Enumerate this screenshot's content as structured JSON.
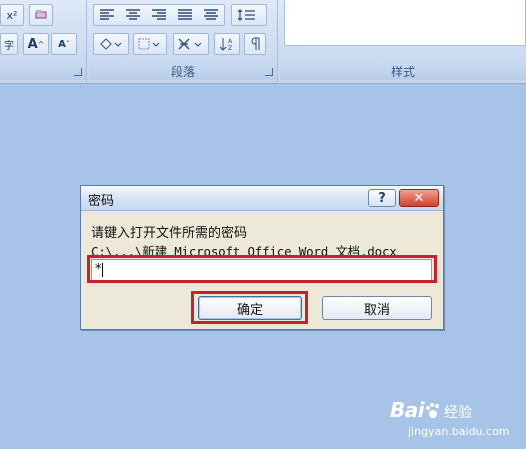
{
  "ribbon": {
    "paragraph_group_label": "段落",
    "styles_group_label": "样式",
    "buttons": {
      "font_grow": "A",
      "font_shrink": "A",
      "subscript": "x²",
      "phonetic": "字"
    }
  },
  "dialog": {
    "title": "密码",
    "help_label": "?",
    "close_label": "✕",
    "prompt": "请键入打开文件所需的密码",
    "file_path": "C:\\...\\新建 Microsoft Office Word 文档.docx",
    "password_value": "*",
    "ok_label": "确定",
    "cancel_label": "取消"
  },
  "watermark": {
    "brand": "Bai",
    "brand_suffix": "经验",
    "url": "jingyan.baidu.com"
  },
  "colors": {
    "desktop": "#a7c4e8",
    "highlight": "#c8202d",
    "dialog_bg": "#ece9d8"
  }
}
